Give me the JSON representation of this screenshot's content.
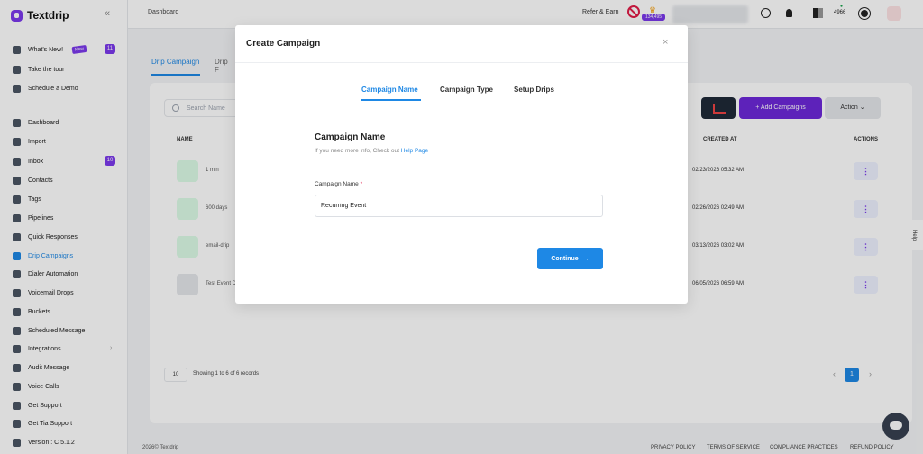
{
  "app": {
    "brand": "Textdrip",
    "collapse_icon": "«"
  },
  "sidebar": {
    "items": [
      {
        "label": "What's New!",
        "badge": "11",
        "tag": "New"
      },
      {
        "label": "Take the tour"
      },
      {
        "label": "Schedule a Demo"
      },
      {
        "label": "Dashboard"
      },
      {
        "label": "Import"
      },
      {
        "label": "Inbox",
        "badge": "10"
      },
      {
        "label": "Contacts"
      },
      {
        "label": "Tags"
      },
      {
        "label": "Pipelines"
      },
      {
        "label": "Quick Responses"
      },
      {
        "label": "Drip Campaigns",
        "active": true
      },
      {
        "label": "Dialer Automation"
      },
      {
        "label": "Voicemail Drops"
      },
      {
        "label": "Buckets"
      },
      {
        "label": "Scheduled Message"
      },
      {
        "label": "Integrations",
        "has_arrow": true
      },
      {
        "label": "Audit Message"
      },
      {
        "label": "Voice Calls"
      },
      {
        "label": "Get Support"
      },
      {
        "label": "Get Tia Support"
      },
      {
        "label": "Version : C 5.1.2"
      }
    ]
  },
  "topbar": {
    "breadcrumb": "Dashboard",
    "refer_label": "Refer & Earn",
    "crown_badge": "134,495",
    "credits": "4966"
  },
  "page": {
    "tab_active": "Drip Campaign",
    "tab_other": "Drip F",
    "search_placeholder": "Search Name",
    "add_button": "Add Campaigns",
    "action_button": "Action",
    "columns": {
      "name": "NAME",
      "created_at": "CREATED AT",
      "actions": "ACTIONS"
    },
    "rows": [
      {
        "name": "1 min",
        "created_at": "02/23/2026 05:32 AM"
      },
      {
        "name": "600 days",
        "created_at": "02/26/2026 02:49 AM"
      },
      {
        "name": "email-drip",
        "created_at": "03/13/2026 03:02 AM"
      },
      {
        "name": "Test Event D",
        "created_at": "06/05/2026 06:59 AM"
      }
    ],
    "row_action_glyph": "⋮",
    "page_size": "10",
    "showing": "Showing 1 to 6 of 6 records",
    "current_page": "1"
  },
  "footer": {
    "copyright": "2026© Textdrip",
    "links": [
      "PRIVACY POLICY",
      "TERMS OF SERVICE",
      "COMPLIANCE PRACTICES",
      "REFUND POLICY"
    ]
  },
  "help_tab": "Help",
  "modal": {
    "title": "Create Campaign",
    "close_glyph": "×",
    "tabs": [
      "Campaign Name",
      "Campaign Type",
      "Setup Drips"
    ],
    "section_title": "Campaign Name",
    "hint_prefix": "If you need more info, Check out",
    "hint_link": "Help Page",
    "field_label": "Campaign Name",
    "required_mark": "*",
    "field_value": "Recurring Event",
    "continue_label": "Continue",
    "continue_arrow": "→"
  },
  "colors": {
    "accent": "#1e88e5",
    "brand": "#7c3aed",
    "required": "#e11d48"
  }
}
